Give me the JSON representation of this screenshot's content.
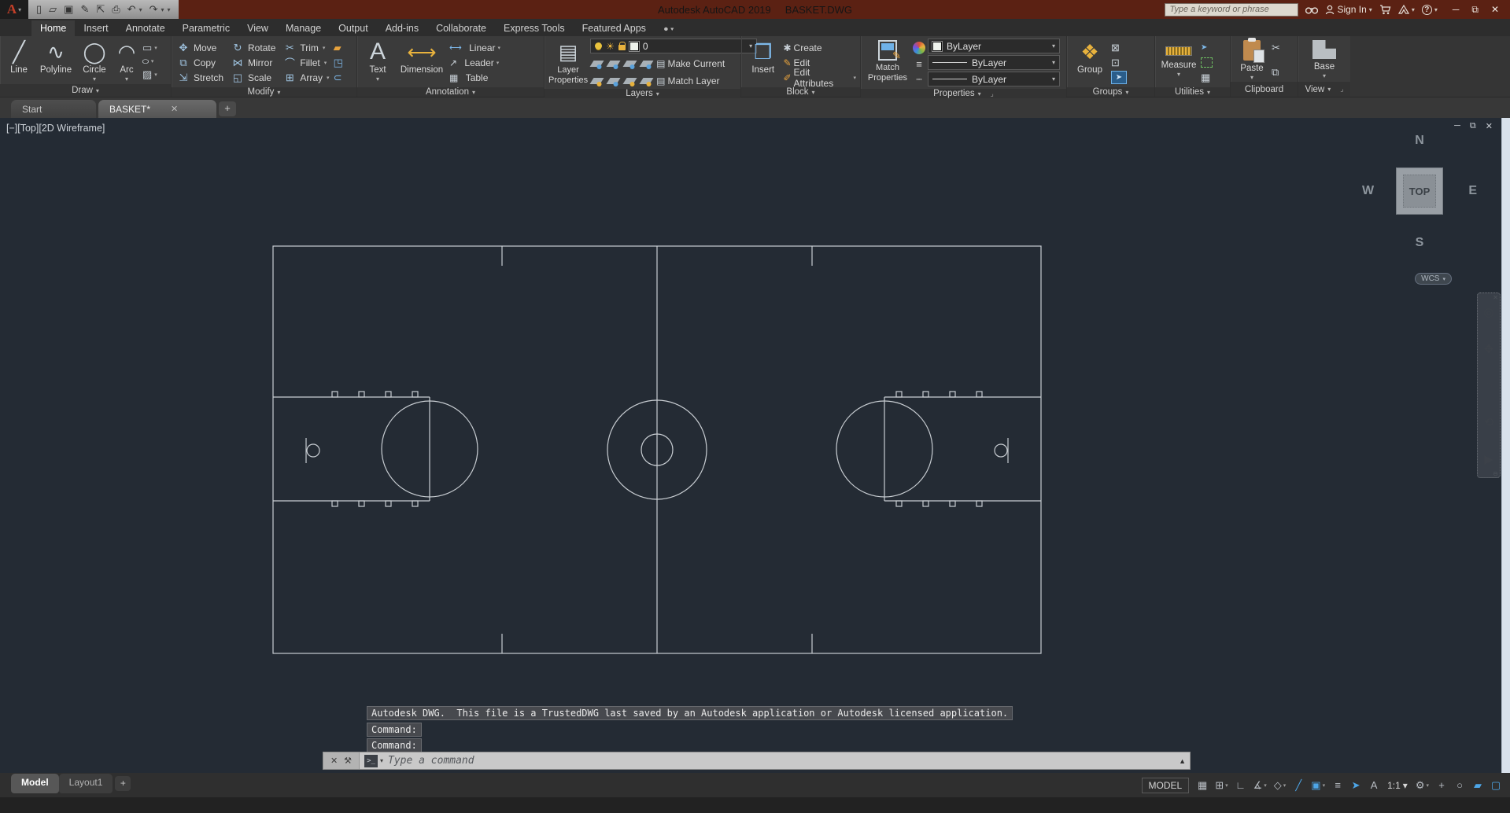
{
  "titlebar": {
    "app_name": "Autodesk AutoCAD 2019",
    "file_name": "BASKET.DWG",
    "search_placeholder": "Type a keyword or phrase",
    "sign_in_label": "Sign In",
    "help_glyph": "?"
  },
  "ribbon_tabs": {
    "home": "Home",
    "insert": "Insert",
    "annotate": "Annotate",
    "parametric": "Parametric",
    "view": "View",
    "manage": "Manage",
    "output": "Output",
    "addins": "Add-ins",
    "collaborate": "Collaborate",
    "express": "Express Tools",
    "featured": "Featured Apps"
  },
  "panels": {
    "draw": {
      "title": "Draw",
      "line": "Line",
      "polyline": "Polyline",
      "circle": "Circle",
      "arc": "Arc"
    },
    "modify": {
      "title": "Modify",
      "move": "Move",
      "rotate": "Rotate",
      "trim": "Trim",
      "copy": "Copy",
      "mirror": "Mirror",
      "fillet": "Fillet",
      "stretch": "Stretch",
      "scale": "Scale",
      "array": "Array"
    },
    "annotation": {
      "title": "Annotation",
      "text": "Text",
      "dimension": "Dimension",
      "linear": "Linear",
      "leader": "Leader",
      "table": "Table"
    },
    "layers": {
      "title": "Layers",
      "layer_properties": "Layer Properties",
      "current_layer": "0",
      "make_current": "Make Current",
      "match_layer": "Match Layer"
    },
    "block": {
      "title": "Block",
      "insert": "Insert",
      "create": "Create",
      "edit": "Edit",
      "edit_attributes": "Edit Attributes"
    },
    "properties": {
      "title": "Properties",
      "match_properties": "Match Properties",
      "object_color": "ByLayer",
      "lineweight": "ByLayer",
      "linetype": "ByLayer"
    },
    "groups": {
      "title": "Groups",
      "group": "Group"
    },
    "utilities": {
      "title": "Utilities",
      "measure": "Measure"
    },
    "clipboard": {
      "title": "Clipboard",
      "paste": "Paste"
    },
    "view": {
      "title": "View",
      "base": "Base"
    }
  },
  "filetabs": {
    "start": "Start",
    "drawing": "BASKET*"
  },
  "viewport": {
    "label": "[−][Top][2D Wireframe]",
    "viewcube_top": "TOP",
    "n": "N",
    "s": "S",
    "e": "E",
    "w": "W",
    "wcs": "WCS"
  },
  "commandline": {
    "history1": "Autodesk DWG.  This file is a TrustedDWG last saved by an Autodesk application or Autodesk licensed application.",
    "history2": "Command:",
    "history3": "Command:",
    "input_placeholder": "Type a command",
    "prompt_glyph": ">_"
  },
  "statusbar": {
    "model_tab": "Model",
    "layout_tab": "Layout1",
    "new_layout": "+",
    "model_space": "MODEL",
    "annotation_scale": "1:1"
  },
  "icons": {
    "caret": "▾",
    "new": "▯",
    "open": "▱",
    "save": "▣",
    "saveas": "✎",
    "export": "⇱",
    "plot": "⎙",
    "undo": "↶",
    "redo": "↷",
    "min": "─",
    "restore": "⧉",
    "close": "✕",
    "line": "╱",
    "polyline": "∿",
    "circle": "◯",
    "arc": "◠",
    "rect_tool": "▭",
    "ellipse_tool": "○",
    "hatch_tool": "▨",
    "move": "✥",
    "rotate": "↻",
    "trim": "✂",
    "copy": "⧉",
    "mirror": "⋈",
    "fillet": "⌒",
    "stretch": "⇲",
    "scale": "◱",
    "array": "⊞",
    "erase": "▰",
    "explode": "◳",
    "offset": "⊂",
    "text": "A",
    "dimension": "⟷",
    "linear": "⟷",
    "leader": "↗",
    "table": "▦",
    "layer_stack": "▤",
    "make_current": "▤",
    "match_layer": "▤",
    "insert_block": "❐",
    "create_block": "✱",
    "edit_block": "✎",
    "edit_attr": "✐",
    "lineweight_rows": "≡",
    "linetype_rows": "┅",
    "group": "❖",
    "ungroup": "⊠",
    "group_edit": "⊡",
    "group_sel": "➤",
    "quick_select": "➤",
    "calculator": "▦",
    "cut": "✂",
    "copy_clip": "⧉",
    "cmd_close": "✕",
    "cmd_tool": "⚒",
    "cmd_up": "▲",
    "nav_wheel": "◎",
    "nav_pan": "✥",
    "nav_zoom": "◌",
    "nav_orbit": "⟲",
    "nav_motion": "▶",
    "grid": "▦",
    "snap": "⊞",
    "ortho": "∟",
    "polar": "∡",
    "iso": "◇",
    "otrack": "╱",
    "osnap": "▣",
    "lwt": "≡",
    "selcycle": "➤",
    "annovis": "A",
    "gear": "⚙",
    "annoplus": "+",
    "isolate": "○",
    "gfx": "▰",
    "cleanscreen": "▢"
  },
  "colors": {
    "titlebar": "#5b2113",
    "ribbon": "#3b3b3b",
    "canvas": "#242b34",
    "court_line": "#c9ced3",
    "accent_blue": "#4da6e8",
    "layer_yellow": "#e8b23d"
  }
}
